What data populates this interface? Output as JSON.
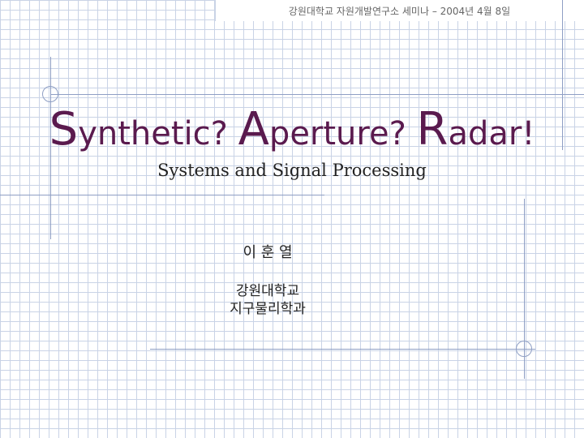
{
  "header": {
    "text": "강원대학교 자원개발연구소 세미나 – 2004년 4월 8일"
  },
  "title": {
    "words": [
      {
        "initial": "S",
        "rest": "ynthetic",
        "punct": "?"
      },
      {
        "initial": "A",
        "rest": "perture",
        "punct": "?"
      },
      {
        "initial": "R",
        "rest": "adar",
        "punct": "!"
      }
    ]
  },
  "subtitle": "Systems and Signal Processing",
  "author": "이 훈 열",
  "affiliation": {
    "university": "강원대학교",
    "department": "지구물리학과"
  },
  "colors": {
    "title": "#5a1a4e",
    "grid": "#c9d3e6",
    "decor": "#8f9fc4"
  }
}
